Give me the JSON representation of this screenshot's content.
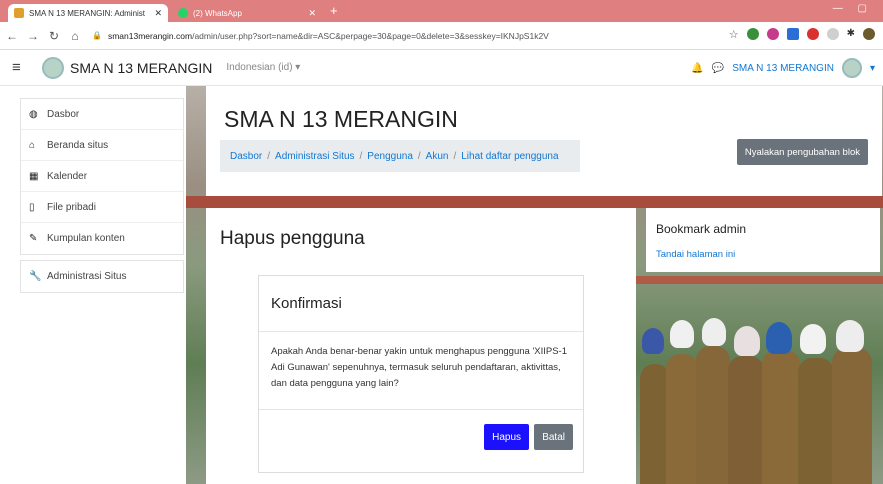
{
  "browser": {
    "tabs": [
      {
        "label": "SMA N 13 MERANGIN: Administ",
        "active": true,
        "favicon_color": "#e0a030"
      },
      {
        "label": "(2) WhatsApp",
        "active": false,
        "favicon_color": "#25d366"
      }
    ],
    "url_host": "sman13merangin.com",
    "url_path": "/admin/user.php?sort=name&dir=ASC&perpage=30&page=0&delete=3&sesskey=IKNJpS1k2V"
  },
  "header": {
    "site_name": "SMA N 13 MERANGIN",
    "language": "Indonesian (id) ▾",
    "user_name": "SMA N 13 MERANGIN"
  },
  "sidebar": {
    "groups": [
      [
        {
          "label": "Dasbor",
          "icon": "dashboard-icon"
        },
        {
          "label": "Beranda situs",
          "icon": "home-icon"
        },
        {
          "label": "Kalender",
          "icon": "calendar-icon"
        },
        {
          "label": "File pribadi",
          "icon": "file-icon"
        },
        {
          "label": "Kumpulan konten",
          "icon": "paintbrush-icon"
        }
      ],
      [
        {
          "label": "Administrasi Situs",
          "icon": "wrench-icon"
        }
      ]
    ]
  },
  "page": {
    "title": "SMA N 13 MERANGIN",
    "breadcrumb": [
      "Dasbor",
      "Administrasi Situs",
      "Pengguna",
      "Akun",
      "Lihat daftar pengguna"
    ],
    "block_edit_button": "Nyalakan pengubahan blok"
  },
  "main": {
    "heading": "Hapus pengguna",
    "dialog": {
      "title": "Konfirmasi",
      "message": "Apakah Anda benar-benar yakin untuk menghapus pengguna 'XIIPS-1 Adi Gunawan' sepenuhnya, termasuk seluruh pendaftaran, aktivittas, dan data pengguna yang lain?",
      "confirm_label": "Hapus",
      "cancel_label": "Batal"
    }
  },
  "bookmark": {
    "title": "Bookmark admin",
    "link": "Tandai halaman ini"
  },
  "colors": {
    "tabbar": "#e07f7f",
    "link": "#1177d1",
    "primary_button": "#1b11ff",
    "secondary_button": "#6a737b"
  }
}
